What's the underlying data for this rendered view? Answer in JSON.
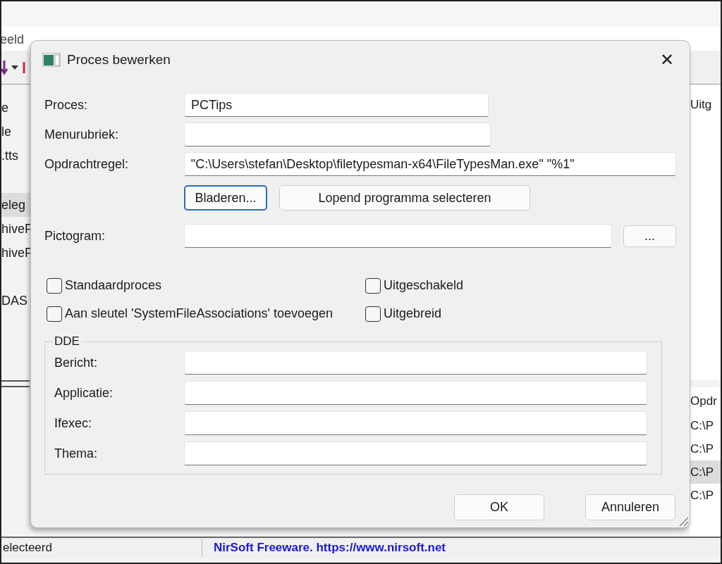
{
  "background_window": {
    "menu": [
      "eeld"
    ],
    "list_column_1": [
      {
        "text": "e",
        "selected": false
      },
      {
        "text": "le",
        "selected": false
      },
      {
        "text": ".tts",
        "selected": false
      },
      {
        "text": "eleg",
        "selected": true
      },
      {
        "text": "hiveF",
        "selected": false
      },
      {
        "text": "hiveF",
        "selected": false
      },
      {
        "text": "DAS",
        "selected": false
      }
    ],
    "list_column_2": {
      "header": "Uitg"
    },
    "lower_list": {
      "header": "Opdr",
      "rows": [
        {
          "text": "C:\\P",
          "selected": false
        },
        {
          "text": "C:\\P",
          "selected": false
        },
        {
          "text": "C:\\P",
          "selected": true
        },
        {
          "text": "C:\\P",
          "selected": false
        }
      ]
    },
    "status_bar": [
      "electeerd",
      "NirSoft Freeware. https://www.nirsoft.net"
    ]
  },
  "dialog": {
    "title": "Proces bewerken",
    "close": "✕",
    "fields": [
      {
        "label": "Proces:",
        "value": "PCTips"
      },
      {
        "label": "Menurubriek:"
      },
      {
        "label": "Opdrachtregel:",
        "value": "\"C:\\Users\\stefan\\Desktop\\filetypesman-x64\\FileTypesMan.exe\" \"%1\""
      }
    ],
    "command_buttons": [
      {
        "label": "Bladeren...",
        "focused": true
      },
      {
        "label": "Lopend programma selecteren",
        "focused": false
      }
    ],
    "icon_field": {
      "label": "Pictogram:",
      "button": "..."
    },
    "checkboxes": [
      {
        "label": "Standaardproces",
        "checked": false
      },
      {
        "label": "Uitgeschakeld",
        "checked": false
      },
      {
        "label": "Aan sleutel 'SystemFileAssociations' toevoegen",
        "checked": false
      },
      {
        "label": "Uitgebreid",
        "checked": false
      }
    ],
    "dde": {
      "title": "DDE",
      "fields": [
        {
          "label": "Bericht:"
        },
        {
          "label": "Applicatie:"
        },
        {
          "label": "Ifexec:"
        },
        {
          "label": "Thema:"
        }
      ]
    },
    "buttons": [
      {
        "label": "OK",
        "focused": false
      },
      {
        "label": "Annuleren",
        "focused": false
      }
    ]
  }
}
